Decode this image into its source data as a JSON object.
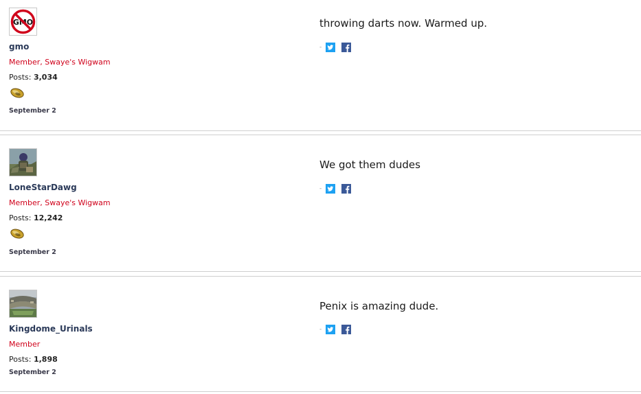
{
  "posts": [
    {
      "avatar": "gmo-no-symbol-avatar",
      "avatar_text": "GMO",
      "username": "gmo",
      "title": "Member, Swaye's Wigwam",
      "posts_label": "Posts:",
      "posts_count": "3,034",
      "has_badge": true,
      "date": "September 2",
      "content": "throwing darts now. Warmed up."
    },
    {
      "avatar": "soldier-photo-avatar",
      "username": "LoneStarDawg",
      "title": "Member, Swaye's Wigwam",
      "posts_label": "Posts:",
      "posts_count": "12,242",
      "has_badge": true,
      "date": "September 2",
      "content": "We got them dudes"
    },
    {
      "avatar": "stadium-photo-avatar",
      "username": "Kingdome_Urinals",
      "title": "Member",
      "posts_label": "Posts:",
      "posts_count": "1,898",
      "has_badge": false,
      "date": "September 2",
      "content": "Penix is amazing dude."
    }
  ],
  "share": {
    "separator": "-",
    "twitter_icon": "twitter-icon",
    "facebook_icon": "facebook-icon"
  },
  "colors": {
    "username": "#2b3a59",
    "title": "#d0021b",
    "twitter": "#1da1f2",
    "facebook": "#3b5998",
    "separator": "#cfcfcf"
  }
}
